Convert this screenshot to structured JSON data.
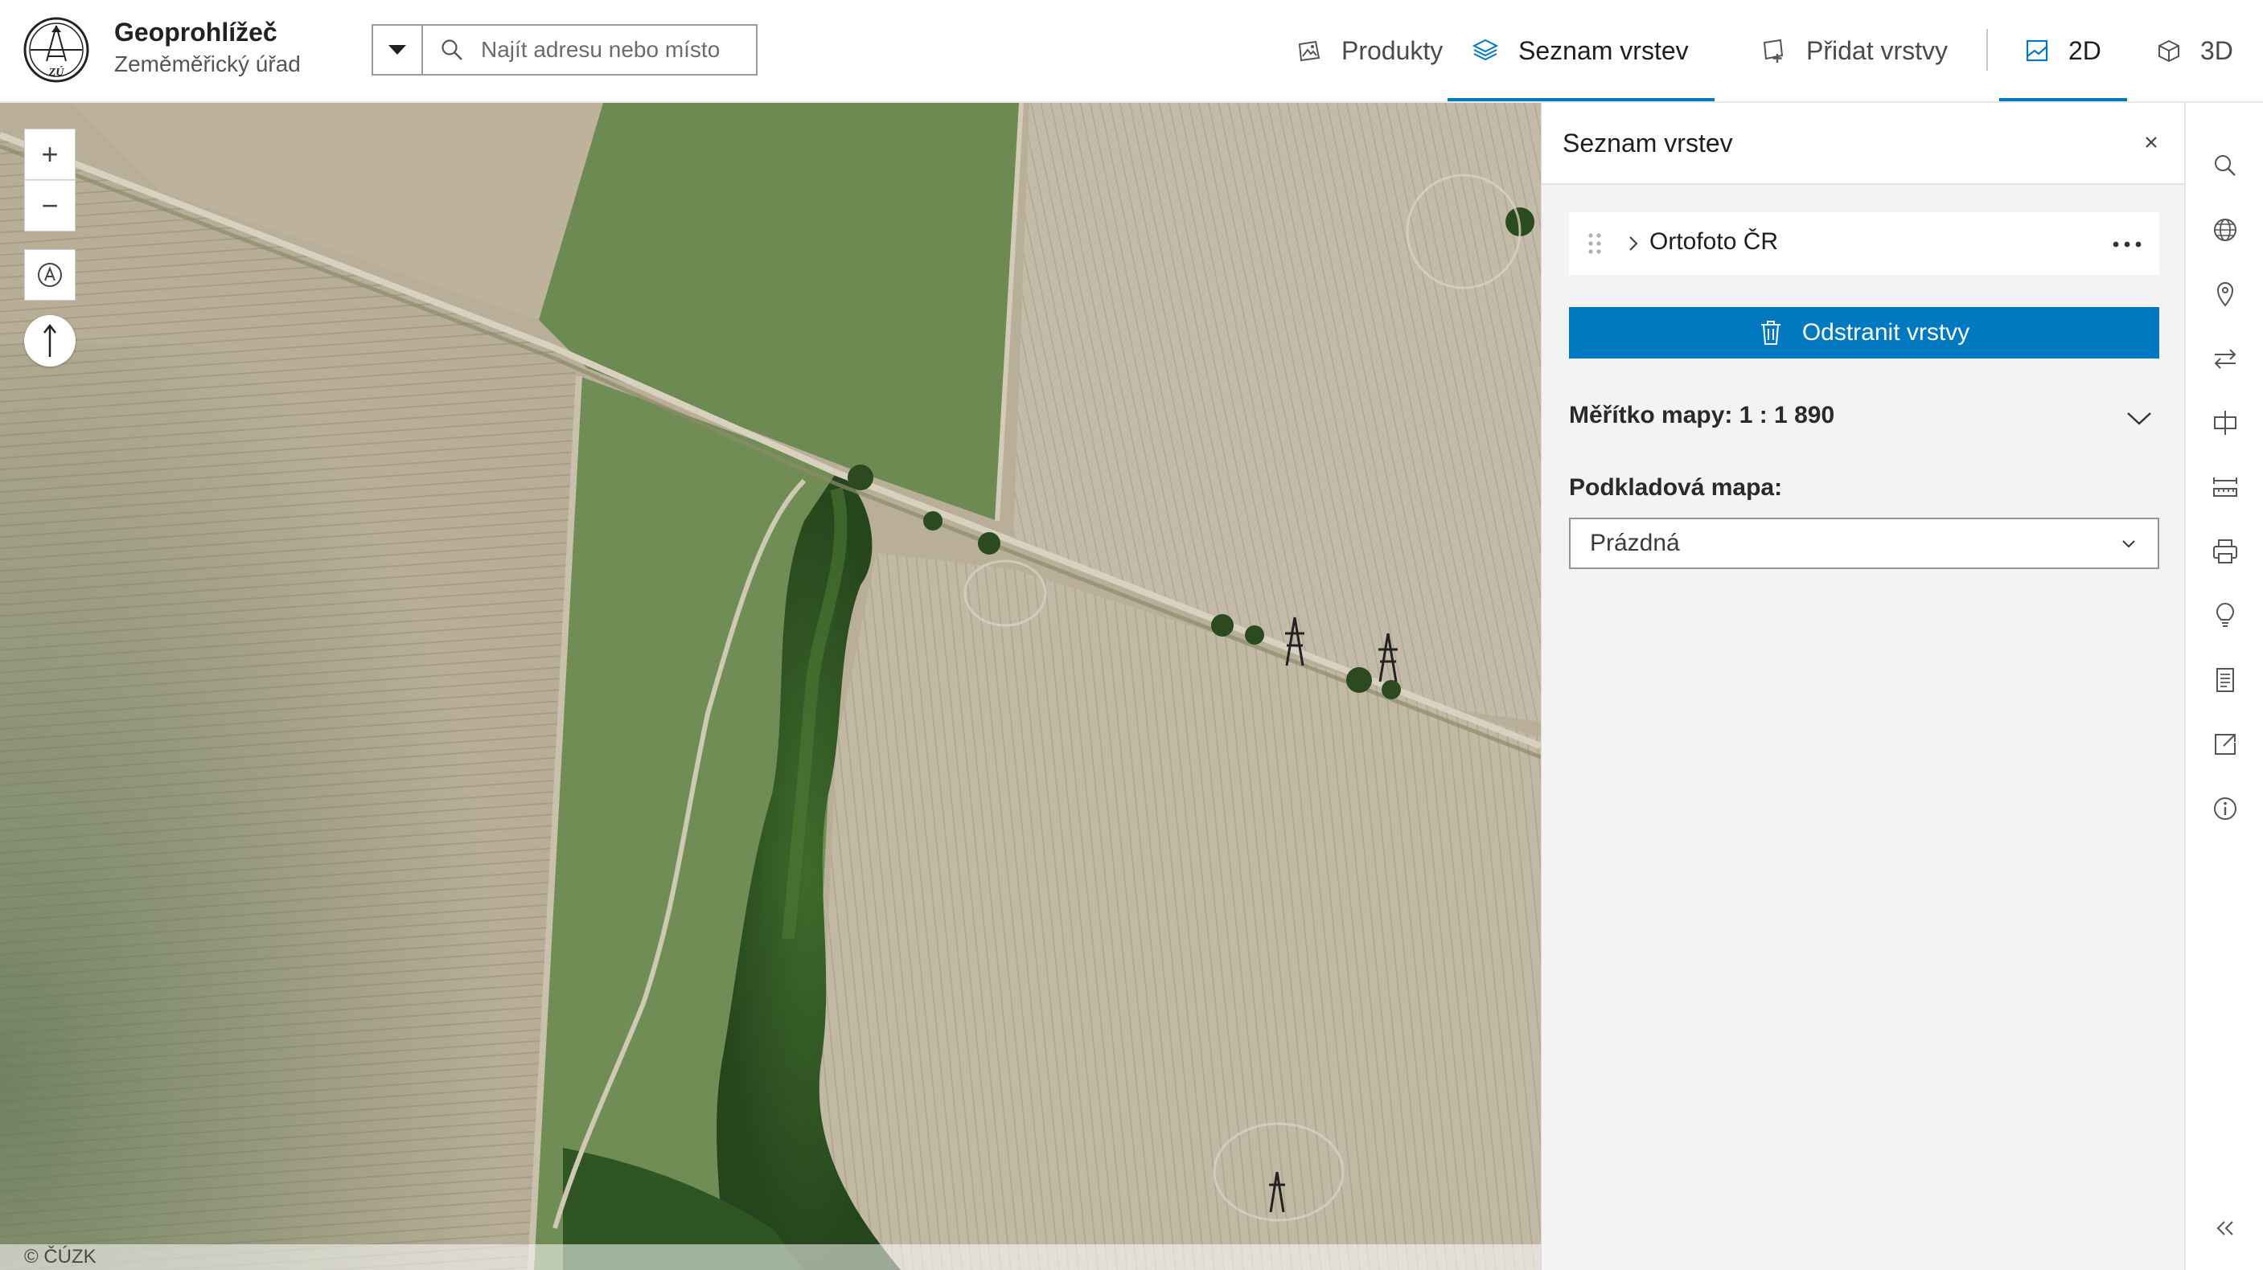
{
  "header": {
    "title": "Geoprohlížeč",
    "subtitle": "Zeměměřický úřad",
    "logo_text": "ZÚ"
  },
  "search": {
    "placeholder": "Najít adresu nebo místo",
    "value": ""
  },
  "nav": {
    "produkty": "Produkty",
    "seznam_vrstev": "Seznam vrstev",
    "pridat_vrstvy": "Přidat vrstvy",
    "view_2d": "2D",
    "view_3d": "3D",
    "active_tab": "Seznam vrstev",
    "active_view": "2D"
  },
  "map": {
    "zoom_in": "+",
    "zoom_out": "−",
    "attribution": "© ČÚZK"
  },
  "panel": {
    "title": "Seznam vrstev",
    "layers": [
      {
        "name": "Ortofoto ČR"
      }
    ],
    "remove_button": "Odstranit vrstvy",
    "scale_label": "Měřítko mapy: 1 : 1 890",
    "basemap_label": "Podkladová mapa:",
    "basemap_value": "Prázdná"
  },
  "actions": [
    "search-icon",
    "globe-icon",
    "location-pin-icon",
    "swap-arrows-icon",
    "split-view-icon",
    "measure-icon",
    "print-icon",
    "lightbulb-icon",
    "document-icon",
    "share-icon",
    "info-icon",
    "collapse-icon"
  ],
  "colors": {
    "accent": "#0079c1",
    "panel_bg": "#f3f3f3"
  }
}
